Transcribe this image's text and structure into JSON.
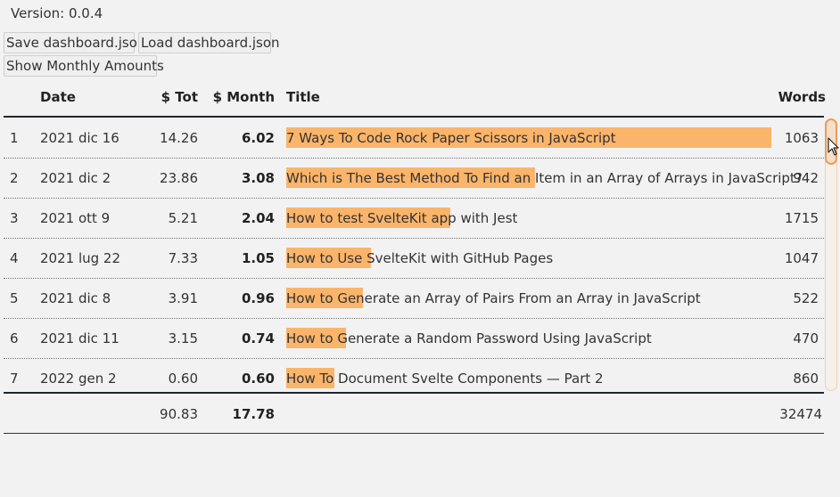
{
  "version": "Version: 0.0.4",
  "buttons": {
    "save": "Save dashboard.json",
    "load": "Load dashboard.json",
    "monthly": "Show Monthly Amounts"
  },
  "table": {
    "headers": {
      "index": "",
      "date": "Date",
      "tot": "$ Tot",
      "month": "$ Month",
      "title": "Title",
      "words": "Words"
    },
    "rows": [
      {
        "idx": "1",
        "date": "2021 dic 16",
        "tot": "14.26",
        "month": "6.02",
        "title": "7 Ways To Code Rock Paper Scissors in JavaScript",
        "words": "1063",
        "bar": 1.0
      },
      {
        "idx": "2",
        "date": "2021 dic 2",
        "tot": "23.86",
        "month": "3.08",
        "title": "Which is The Best Method To Find an Item in an Array of Arrays in JavaScript?",
        "words": "942",
        "bar": 0.512
      },
      {
        "idx": "3",
        "date": "2021 ott 9",
        "tot": "5.21",
        "month": "2.04",
        "title": "How to test SvelteKit app with Jest",
        "words": "1715",
        "bar": 0.339
      },
      {
        "idx": "4",
        "date": "2021 lug 22",
        "tot": "7.33",
        "month": "1.05",
        "title": "How to Use SvelteKit with GitHub Pages",
        "words": "1047",
        "bar": 0.174
      },
      {
        "idx": "5",
        "date": "2021 dic 8",
        "tot": "3.91",
        "month": "0.96",
        "title": "How to Generate an Array of Pairs From an Array in JavaScript",
        "words": "522",
        "bar": 0.159
      },
      {
        "idx": "6",
        "date": "2021 dic 11",
        "tot": "3.15",
        "month": "0.74",
        "title": "How to Generate a Random Password Using JavaScript",
        "words": "470",
        "bar": 0.123
      },
      {
        "idx": "7",
        "date": "2022 gen 2",
        "tot": "0.60",
        "month": "0.60",
        "title": "How To Document Svelte Components — Part 2",
        "words": "860",
        "bar": 0.1
      }
    ],
    "totals": {
      "tot": "90.83",
      "month": "17.78",
      "words": "32474"
    }
  },
  "colors": {
    "bar": "#fbb56a",
    "rule": "#1e2533",
    "background": "#f2f2f3"
  },
  "scrollbar": {
    "position": 0.0
  }
}
